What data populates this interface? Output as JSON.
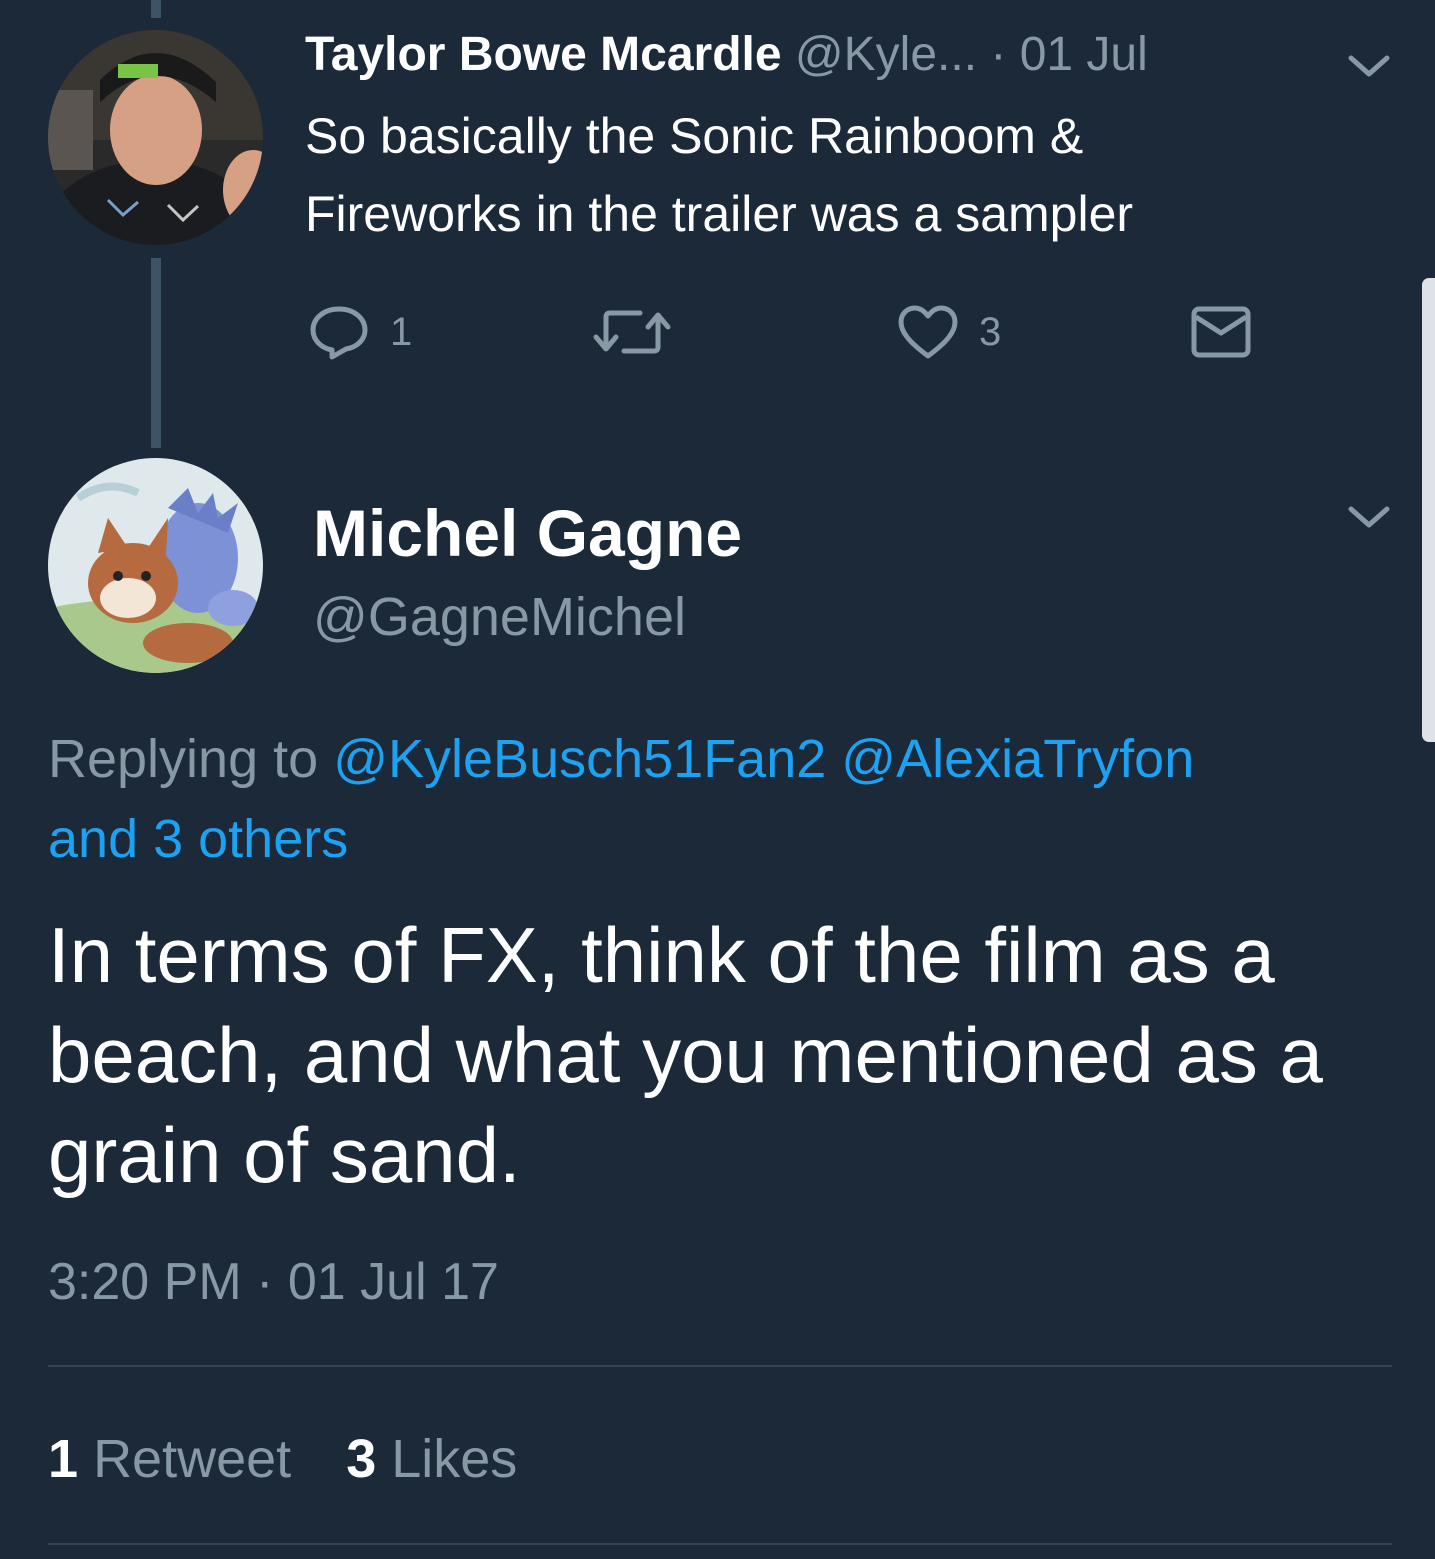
{
  "tweets": [
    {
      "author_name": "Taylor Bowe Mcardle",
      "handle": "@Kyle...",
      "separator": "·",
      "date": "01 Jul",
      "text_line1": "So basically the Sonic Rainboom &",
      "text_line2": "Fireworks in the trailer was a sampler",
      "actions": {
        "reply_count": "1",
        "retweet_count": "",
        "like_count": "3"
      }
    }
  ],
  "main_tweet": {
    "author_name": "Michel Gagne",
    "handle": "@GagneMichel",
    "replying_prefix": "Replying to",
    "reply_mention_1": "@KyleBusch51Fan2",
    "reply_mention_2": "@AlexiaTryfon",
    "reply_others": "and 3 others",
    "text": "In terms of FX, think of the film as a beach, and what you mentioned as a grain of sand.",
    "time": "3:20 PM",
    "separator": "·",
    "date": "01 Jul 17",
    "stats": {
      "retweet_count": "1",
      "retweet_label": "Retweet",
      "like_count": "3",
      "like_label": "Likes"
    }
  },
  "icons": {
    "reply": "reply-icon",
    "retweet": "retweet-icon",
    "like": "heart-icon",
    "message": "envelope-icon",
    "caret": "chevron-down-icon"
  },
  "colors": {
    "background": "#1c2938",
    "link": "#1da1f2",
    "muted": "#8899a6",
    "text": "#ffffff",
    "divider": "#38444d"
  }
}
